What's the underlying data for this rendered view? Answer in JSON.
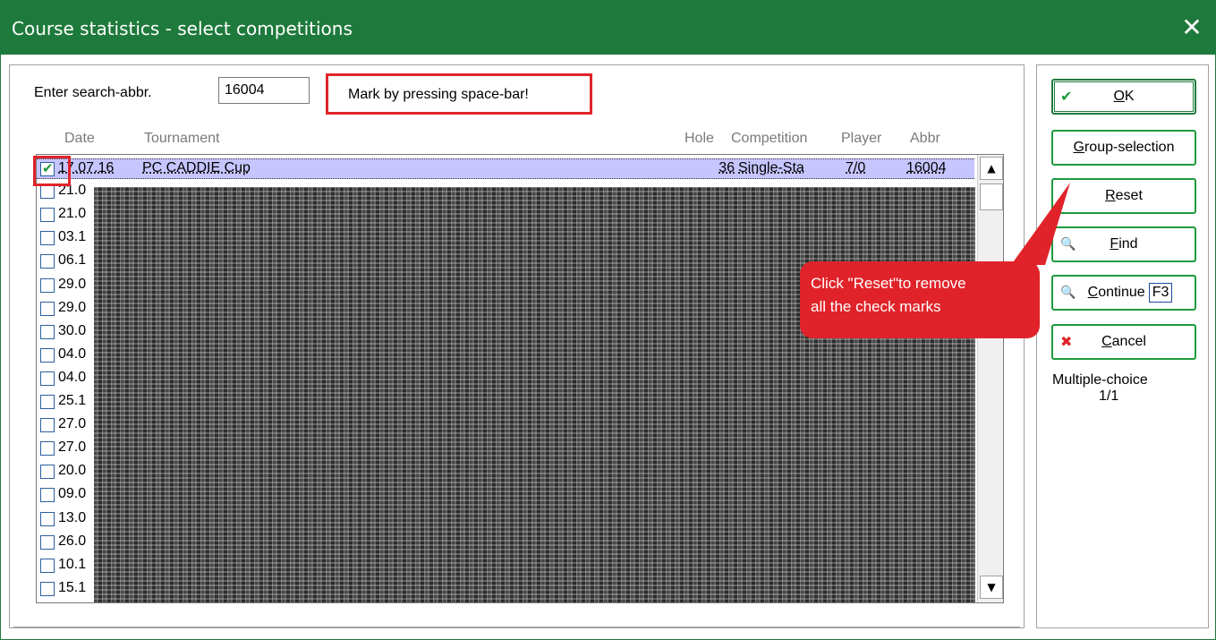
{
  "window": {
    "title": "Course statistics - select competitions",
    "close_glyph": "✕"
  },
  "search": {
    "label": "Enter search-abbr.",
    "value": "16004"
  },
  "hint": {
    "text": "Mark by pressing space-bar!"
  },
  "columns": {
    "date": "Date",
    "tournament": "Tournament",
    "hole": "Hole",
    "competition": "Competition",
    "player": "Player",
    "abbr": "Abbr"
  },
  "rows": [
    {
      "checked": true,
      "date": "17.07.16",
      "tournament": "PC CADDIE Cup",
      "hole": "36",
      "competition": "Single-Sta",
      "player": "7/0",
      "abbr": "16004"
    },
    {
      "checked": false,
      "date": "21.0",
      "tournament": "",
      "hole": "",
      "competition": "",
      "player": "",
      "abbr": ""
    },
    {
      "checked": false,
      "date": "21.0",
      "tournament": "",
      "hole": "",
      "competition": "",
      "player": "",
      "abbr": ""
    },
    {
      "checked": false,
      "date": "03.1",
      "tournament": "",
      "hole": "",
      "competition": "",
      "player": "",
      "abbr": ""
    },
    {
      "checked": false,
      "date": "06.1",
      "tournament": "",
      "hole": "",
      "competition": "",
      "player": "",
      "abbr": ""
    },
    {
      "checked": false,
      "date": "29.0",
      "tournament": "",
      "hole": "",
      "competition": "",
      "player": "",
      "abbr": ""
    },
    {
      "checked": false,
      "date": "29.0",
      "tournament": "",
      "hole": "",
      "competition": "",
      "player": "",
      "abbr": ""
    },
    {
      "checked": false,
      "date": "30.0",
      "tournament": "",
      "hole": "",
      "competition": "",
      "player": "",
      "abbr": ""
    },
    {
      "checked": false,
      "date": "04.0",
      "tournament": "",
      "hole": "",
      "competition": "",
      "player": "",
      "abbr": ""
    },
    {
      "checked": false,
      "date": "04.0",
      "tournament": "",
      "hole": "",
      "competition": "",
      "player": "",
      "abbr": ""
    },
    {
      "checked": false,
      "date": "25.1",
      "tournament": "",
      "hole": "",
      "competition": "",
      "player": "",
      "abbr": ""
    },
    {
      "checked": false,
      "date": "27.0",
      "tournament": "",
      "hole": "",
      "competition": "",
      "player": "",
      "abbr": ""
    },
    {
      "checked": false,
      "date": "27.0",
      "tournament": "",
      "hole": "",
      "competition": "",
      "player": "",
      "abbr": ""
    },
    {
      "checked": false,
      "date": "20.0",
      "tournament": "",
      "hole": "",
      "competition": "",
      "player": "",
      "abbr": ""
    },
    {
      "checked": false,
      "date": "09.0",
      "tournament": "",
      "hole": "",
      "competition": "",
      "player": "",
      "abbr": ""
    },
    {
      "checked": false,
      "date": "13.0",
      "tournament": "",
      "hole": "",
      "competition": "",
      "player": "",
      "abbr": ""
    },
    {
      "checked": false,
      "date": "26.0",
      "tournament": "",
      "hole": "",
      "competition": "",
      "player": "",
      "abbr": ""
    },
    {
      "checked": false,
      "date": "10.1",
      "tournament": "",
      "hole": "",
      "competition": "",
      "player": "",
      "abbr": ""
    },
    {
      "checked": false,
      "date": "15.1",
      "tournament": "",
      "hole": "",
      "competition": "",
      "player": "",
      "abbr": ""
    }
  ],
  "buttons": {
    "ok": {
      "icon": "check-icon",
      "glyph": "✔",
      "mnemonic": "O",
      "rest": "K"
    },
    "group": {
      "mnemonic": "G",
      "rest": "roup-selection"
    },
    "reset": {
      "mnemonic": "R",
      "rest": "eset"
    },
    "find": {
      "icon": "magnifier-icon",
      "glyph": "🔍",
      "mnemonic": "F",
      "rest": "ind"
    },
    "continue": {
      "icon": "continue-search-icon",
      "glyph": "🔍",
      "mnemonic": "C",
      "rest": "ontinue",
      "key": "F3"
    },
    "cancel": {
      "icon": "x-icon",
      "glyph": "✖",
      "mnemonic": "C",
      "rest": "ancel"
    }
  },
  "multiple_choice": {
    "label": "Multiple-choice",
    "count": "1/1"
  },
  "callout": {
    "line1": "Click \"Reset\"to remove",
    "line2": "all the check marks"
  },
  "scrollbar": {
    "up_glyph": "▲",
    "down_glyph": "▼"
  },
  "colors": {
    "titlebar": "#1e7a3c",
    "highlight": "#e0232a",
    "selected_row": "#c7c5ff",
    "button_border": "#1e9a3c"
  }
}
